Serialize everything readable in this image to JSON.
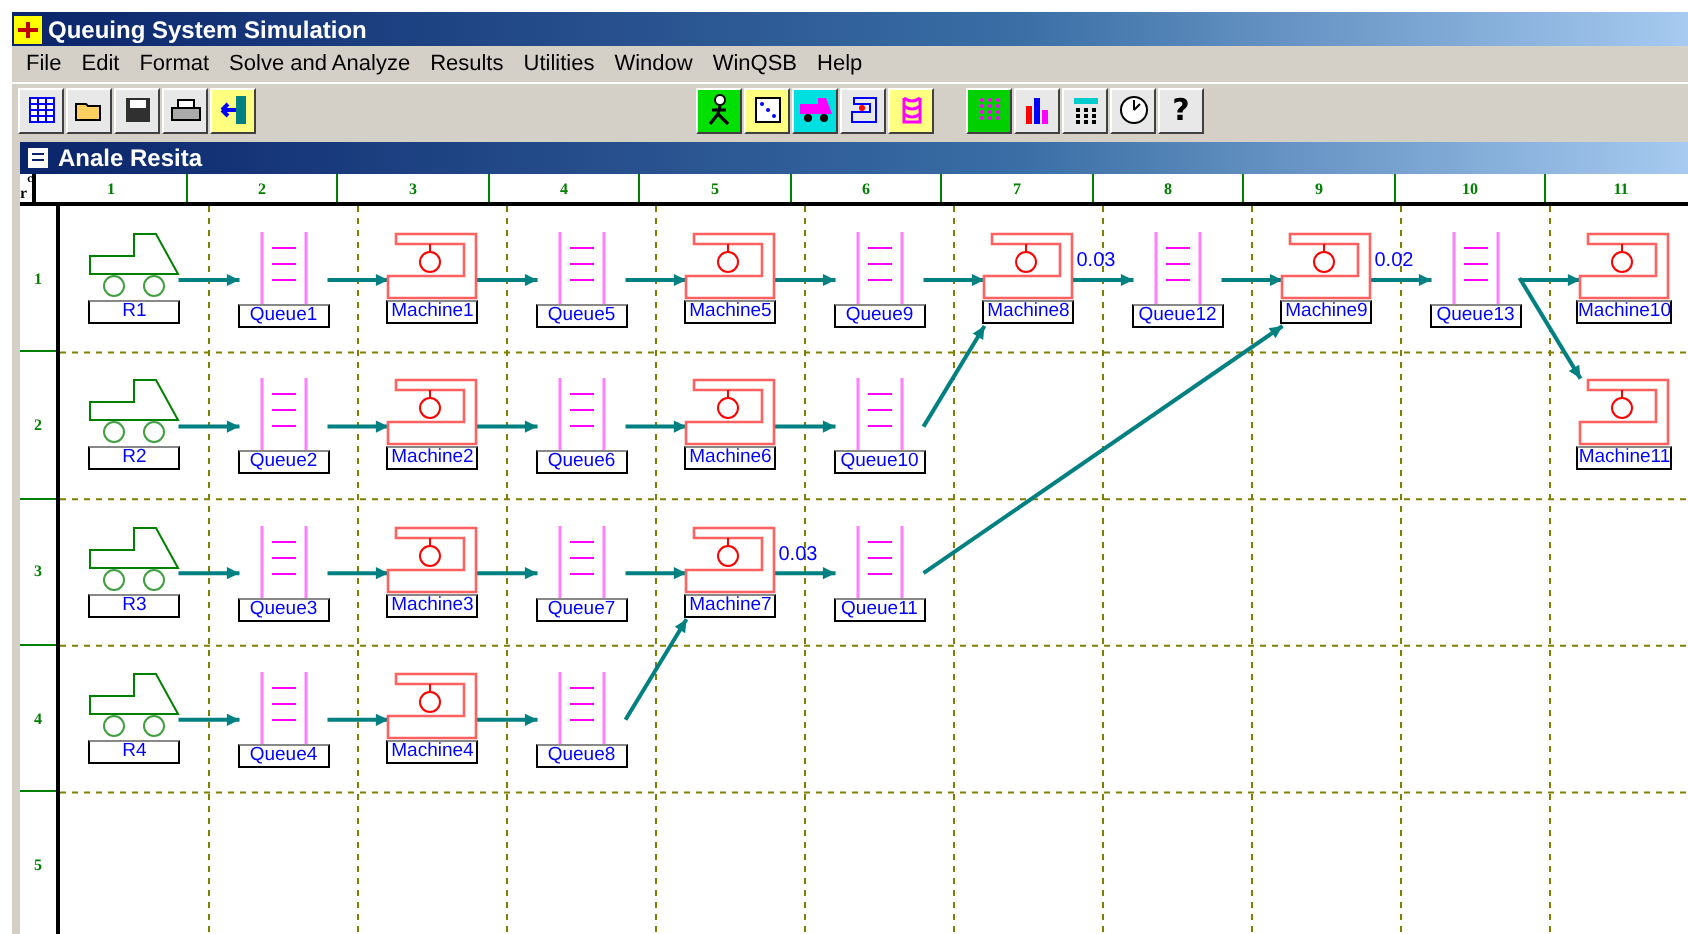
{
  "window": {
    "title": "Queuing System Simulation"
  },
  "menu": [
    "File",
    "Edit",
    "Format",
    "Solve and Analyze",
    "Results",
    "Utilities",
    "Window",
    "WinQSB",
    "Help"
  ],
  "toolbar": [
    {
      "kind": "table"
    },
    {
      "kind": "open"
    },
    {
      "kind": "save"
    },
    {
      "kind": "print"
    },
    {
      "kind": "exit"
    },
    {
      "kind": "gap"
    },
    {
      "kind": "customer"
    },
    {
      "kind": "dice"
    },
    {
      "kind": "cart"
    },
    {
      "kind": "machine"
    },
    {
      "kind": "queue"
    },
    {
      "kind": "gap"
    },
    {
      "kind": "grid"
    },
    {
      "kind": "bars"
    },
    {
      "kind": "calculator"
    },
    {
      "kind": "clock"
    },
    {
      "kind": "help",
      "label": "?"
    }
  ],
  "document": {
    "title": "Anale Resita",
    "corner_row": "r",
    "corner_column": "c"
  },
  "columns": [
    "1",
    "2",
    "3",
    "4",
    "5",
    "6",
    "7",
    "8",
    "9",
    "10",
    "11"
  ],
  "rows": [
    {
      "label": "1",
      "cells": [
        {
          "kind": "source",
          "label": "R1"
        },
        {
          "kind": "queue",
          "label": "Queue1"
        },
        {
          "kind": "server",
          "label": "Machine1"
        },
        {
          "kind": "queue",
          "label": "Queue5"
        },
        {
          "kind": "server",
          "label": "Machine5"
        },
        {
          "kind": "queue",
          "label": "Queue9"
        },
        {
          "kind": "server",
          "label": "Machine8",
          "out_label": "0.03"
        },
        {
          "kind": "queue",
          "label": "Queue12"
        },
        {
          "kind": "server",
          "label": "Machine9",
          "out_label": "0.02"
        },
        {
          "kind": "queue",
          "label": "Queue13"
        },
        {
          "kind": "server",
          "label": "Machine10"
        }
      ]
    },
    {
      "label": "2",
      "cells": [
        {
          "kind": "source",
          "label": "R2"
        },
        {
          "kind": "queue",
          "label": "Queue2"
        },
        {
          "kind": "server",
          "label": "Machine2"
        },
        {
          "kind": "queue",
          "label": "Queue6"
        },
        {
          "kind": "server",
          "label": "Machine6"
        },
        {
          "kind": "queue",
          "label": "Queue10"
        },
        {
          "kind": "empty"
        },
        {
          "kind": "empty"
        },
        {
          "kind": "empty"
        },
        {
          "kind": "empty"
        },
        {
          "kind": "server",
          "label": "Machine11"
        }
      ]
    },
    {
      "label": "3",
      "cells": [
        {
          "kind": "source",
          "label": "R3"
        },
        {
          "kind": "queue",
          "label": "Queue3"
        },
        {
          "kind": "server",
          "label": "Machine3"
        },
        {
          "kind": "queue",
          "label": "Queue7"
        },
        {
          "kind": "server",
          "label": "Machine7",
          "out_label": "0.03"
        },
        {
          "kind": "queue",
          "label": "Queue11"
        }
      ]
    },
    {
      "label": "4",
      "cells": [
        {
          "kind": "source",
          "label": "R4"
        },
        {
          "kind": "queue",
          "label": "Queue4"
        },
        {
          "kind": "server",
          "label": "Machine4"
        },
        {
          "kind": "queue",
          "label": "Queue8"
        }
      ]
    },
    {
      "label": "5"
    }
  ]
}
